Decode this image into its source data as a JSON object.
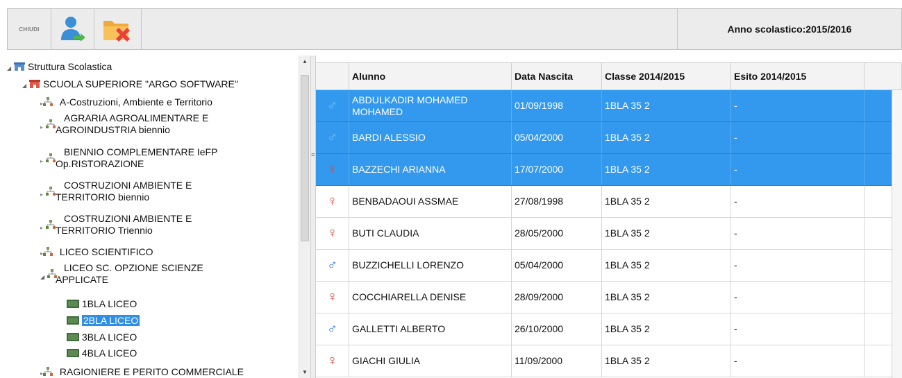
{
  "toolbar": {
    "close_label": "CHIUDI",
    "user_icon": "user-arrow-icon",
    "folder_icon": "folder-delete-icon",
    "school_year": "Anno scolastico:2015/2016"
  },
  "tree": {
    "root": "Struttura Scolastica",
    "school": "SCUOLA SUPERIORE \"ARGO SOFTWARE\"",
    "nodes": [
      {
        "l1": "A-Costruzioni, Ambiente e Territorio",
        "l2": ""
      },
      {
        "l1": "AGRARIA AGROALIMENTARE E",
        "l2": "AGROINDUSTRIA biennio"
      },
      {
        "l1": "BIENNIO COMPLEMENTARE IeFP",
        "l2": "Op.RISTORAZIONE"
      },
      {
        "l1": "COSTRUZIONI AMBIENTE E",
        "l2": "TERRITORIO biennio"
      },
      {
        "l1": "COSTRUZIONI AMBIENTE E",
        "l2": "TERRITORIO Triennio"
      },
      {
        "l1": "LICEO SCIENTIFICO",
        "l2": ""
      },
      {
        "l1": "LICEO SC. OPZIONE SCIENZE",
        "l2": "APPLICATE"
      }
    ],
    "classes": [
      "1BLA LICEO",
      "2BLA LICEO",
      "3BLA LICEO",
      "4BLA LICEO"
    ],
    "selected_class": "2BLA LICEO",
    "last_node": "RAGIONIERE E PERITO COMMERCIALE"
  },
  "grid": {
    "columns": [
      "Alunno",
      "Data Nascita",
      "Classe 2014/2015",
      "Esito 2014/2015"
    ],
    "rows": [
      {
        "name": "ABDULKADIR MOHAMED MOHAMED",
        "gender": "M",
        "symbol": "♂",
        "birth": "01/09/1998",
        "class": "1BLA 35 2",
        "esito": "-",
        "selected": true
      },
      {
        "name": "BARDI ALESSIO",
        "gender": "M",
        "symbol": "♂",
        "birth": "05/04/2000",
        "class": "1BLA 35 2",
        "esito": "-",
        "selected": true
      },
      {
        "name": "BAZZECHI ARIANNA",
        "gender": "F",
        "symbol": "♀",
        "birth": "17/07/2000",
        "class": "1BLA 35 2",
        "esito": "-",
        "selected": true
      },
      {
        "name": "BENBADAOUI ASSMAE",
        "gender": "F",
        "symbol": "♀",
        "birth": "27/08/1998",
        "class": "1BLA 35 2",
        "esito": "-",
        "selected": false
      },
      {
        "name": "BUTI CLAUDIA",
        "gender": "F",
        "symbol": "♀",
        "birth": "28/05/2000",
        "class": "1BLA 35 2",
        "esito": "-",
        "selected": false
      },
      {
        "name": "BUZZICHELLI LORENZO",
        "gender": "M",
        "symbol": "♂",
        "birth": "05/04/2000",
        "class": "1BLA 35 2",
        "esito": "-",
        "selected": false
      },
      {
        "name": "COCCHIARELLA DENISE",
        "gender": "F",
        "symbol": "♀",
        "birth": "28/09/2000",
        "class": "1BLA 35 2",
        "esito": "-",
        "selected": false
      },
      {
        "name": "GALLETTI ALBERTO",
        "gender": "M",
        "symbol": "♂",
        "birth": "26/10/2000",
        "class": "1BLA 35 2",
        "esito": "-",
        "selected": false
      },
      {
        "name": "GIACHI GIULIA",
        "gender": "F",
        "symbol": "♀",
        "birth": "11/09/2000",
        "class": "1BLA 35 2",
        "esito": "-",
        "selected": false
      }
    ]
  },
  "colors": {
    "selection": "#3399ee",
    "male": "#2f77c8",
    "female": "#e04434"
  }
}
